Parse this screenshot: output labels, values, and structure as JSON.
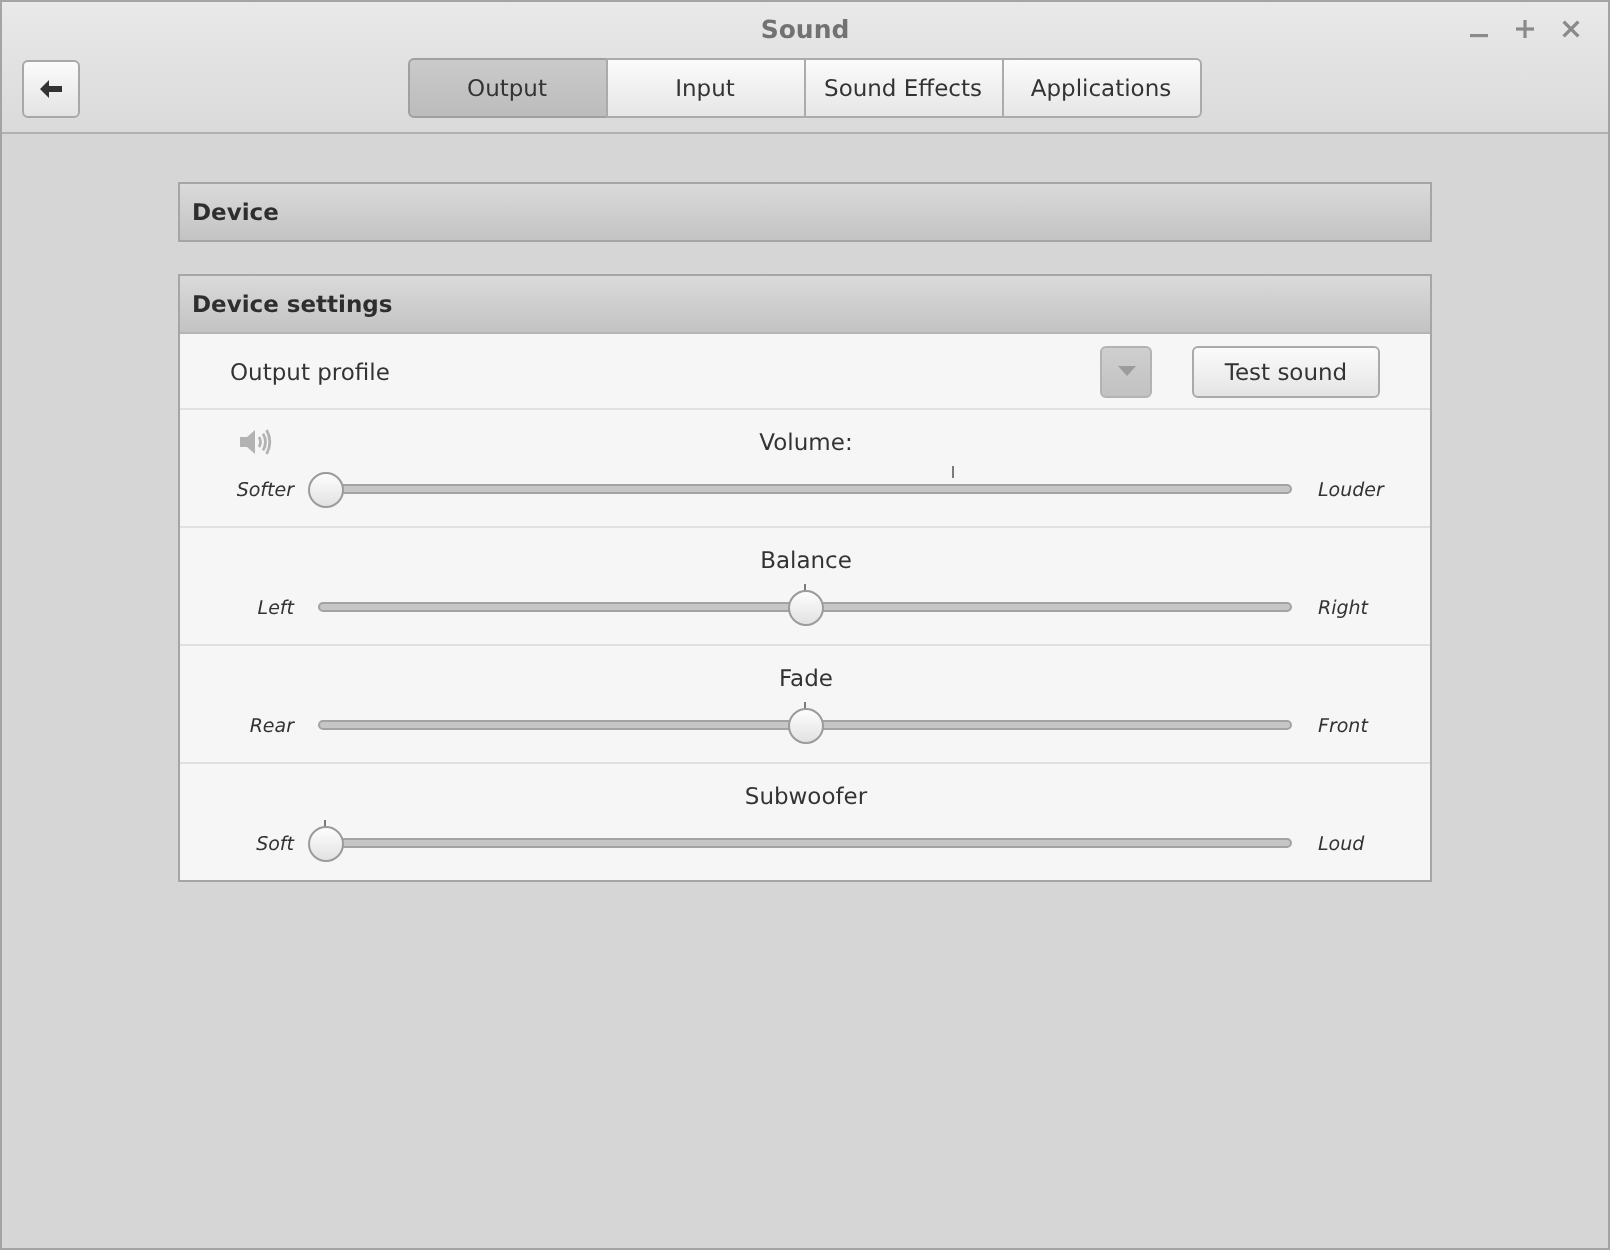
{
  "window": {
    "title": "Sound"
  },
  "tabs": [
    {
      "label": "Output",
      "selected": true
    },
    {
      "label": "Input",
      "selected": false
    },
    {
      "label": "Sound Effects",
      "selected": false
    },
    {
      "label": "Applications",
      "selected": false
    }
  ],
  "device_section": {
    "title": "Device"
  },
  "settings_section": {
    "title": "Device settings",
    "output_profile": {
      "label": "Output profile",
      "dropdown": {
        "disabled": true
      },
      "test_button": "Test sound"
    },
    "sliders": [
      {
        "kind": "volume",
        "label": "Volume:",
        "min_label": "Softer",
        "max_label": "Louder",
        "level": 0
      },
      {
        "kind": "centered",
        "label": "Balance",
        "min_label": "Left",
        "max_label": "Right",
        "level": 0.5
      },
      {
        "kind": "centered",
        "label": "Fade",
        "min_label": "Rear",
        "max_label": "Front",
        "level": 0.5
      },
      {
        "kind": "from_zero",
        "label": "Subwoofer",
        "min_label": "Soft",
        "max_label": "Loud",
        "level": 0
      }
    ]
  }
}
